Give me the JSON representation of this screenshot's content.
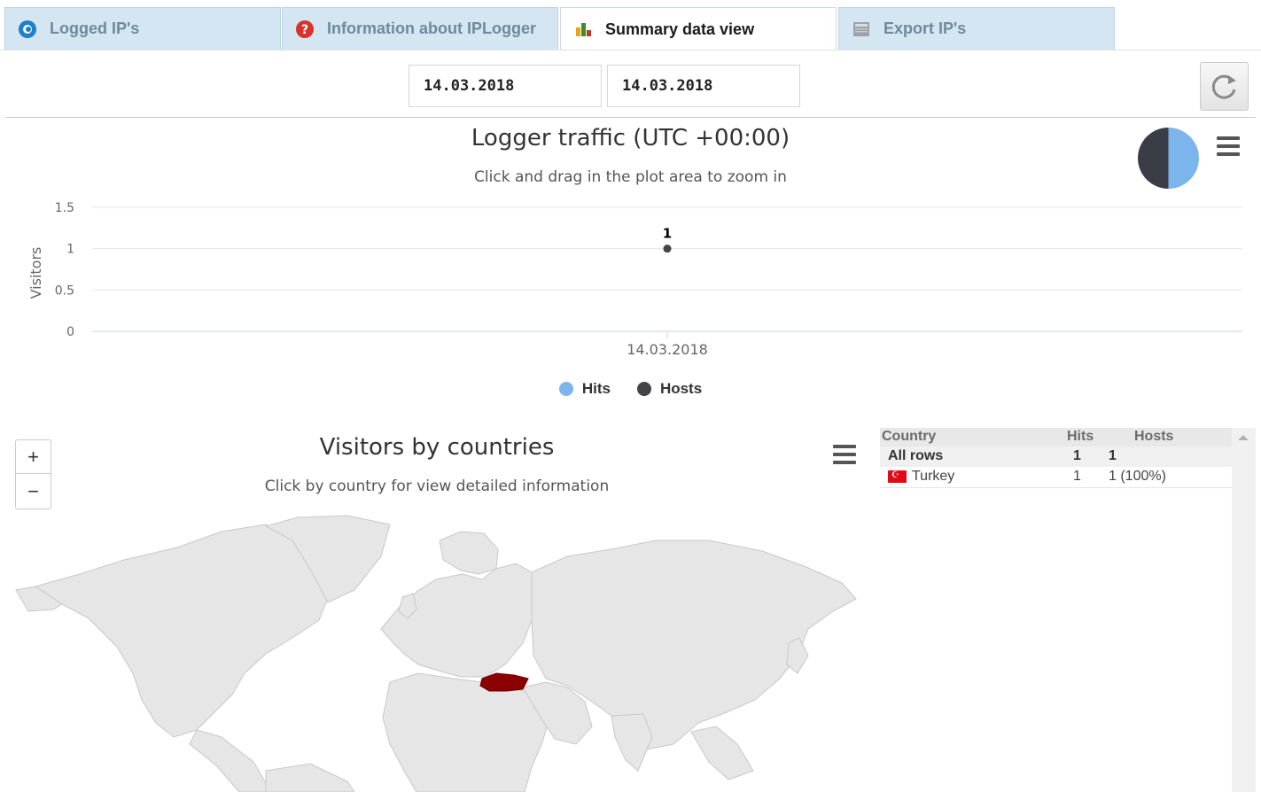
{
  "tabs": [
    {
      "label": "Logged IP's",
      "icon": "eye-icon",
      "active": false
    },
    {
      "label": "Information about IPLogger",
      "icon": "question-icon",
      "active": false
    },
    {
      "label": "Summary data view",
      "icon": "bar-chart-icon",
      "active": true
    },
    {
      "label": "Export IP's",
      "icon": "document-icon",
      "active": false
    }
  ],
  "filters": {
    "date_from": "14.03.2018",
    "date_to": "14.03.2018",
    "refresh_icon": "refresh-icon"
  },
  "traffic_chart": {
    "title": "Logger traffic (UTC +00:00)",
    "subtitle": "Click and drag in the plot area to zoom in",
    "menu_icon": "hamburger-menu-icon"
  },
  "legend": {
    "hits": "Hits",
    "hosts": "Hosts"
  },
  "map": {
    "title": "Visitors by countries",
    "subtitle": "Click by country for view detailed information",
    "zoom_in": "+",
    "zoom_out": "−",
    "highlight_color": "#8b0000",
    "land_color": "#e6e6e6"
  },
  "country_table": {
    "headers": {
      "country": "Country",
      "hits": "Hits",
      "hosts": "Hosts"
    },
    "all_rows": {
      "label": "All rows",
      "hits": "1",
      "hosts": "1"
    },
    "rows": [
      {
        "country": "Turkey",
        "hits": "1",
        "hosts": "1 (100%)",
        "flag": "turkey-flag-icon"
      }
    ]
  },
  "colors": {
    "hits": "#7cb5ec",
    "hosts": "#434348",
    "tab_inactive_bg": "#d4e6f1"
  },
  "chart_data": {
    "type": "line",
    "title": "Logger traffic (UTC +00:00)",
    "subtitle": "Click and drag in the plot area to zoom in",
    "xlabel": "",
    "ylabel": "Visitors",
    "categories": [
      "14.03.2018"
    ],
    "ylim": [
      0,
      1.5
    ],
    "yticks": [
      "0",
      "0.5",
      "1",
      "1.5"
    ],
    "series": [
      {
        "name": "Hits",
        "values": [
          1
        ],
        "color": "#7cb5ec"
      },
      {
        "name": "Hosts",
        "values": [
          1
        ],
        "color": "#434348"
      }
    ],
    "data_labels": [
      "1"
    ],
    "grid": true,
    "legend": "bottom-center"
  }
}
